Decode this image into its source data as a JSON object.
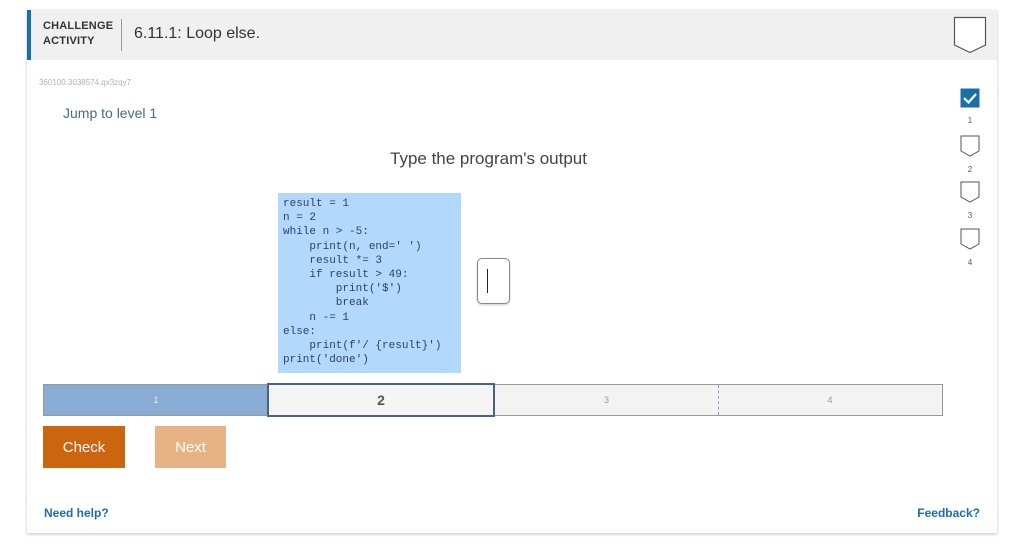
{
  "header": {
    "tag_line1": "CHALLENGE",
    "tag_line2": "ACTIVITY",
    "title": "6.11.1: Loop else."
  },
  "activity_id": "360100.3038574.qx3zqy7",
  "jump_link": "Jump to level 1",
  "prompt": "Type the program's output",
  "code_lines": [
    "result = 1",
    "n = 2",
    "while n > -5:",
    "    print(n, end=' ')",
    "    result *= 3",
    "    if result > 49:",
    "        print('$')",
    "        break",
    "    n -= 1",
    "else:",
    "    print(f'/ {result}')",
    "print('done')"
  ],
  "answer": {
    "value": ""
  },
  "side_levels": [
    {
      "num": "1",
      "state": "completed"
    },
    {
      "num": "2",
      "state": "pending"
    },
    {
      "num": "3",
      "state": "pending"
    },
    {
      "num": "4",
      "state": "pending"
    }
  ],
  "progress": {
    "segments": [
      {
        "label": "1",
        "state": "done"
      },
      {
        "label": "2",
        "state": "current"
      },
      {
        "label": "3",
        "state": "pending"
      },
      {
        "label": "4",
        "state": "pending"
      }
    ]
  },
  "buttons": {
    "check": "Check",
    "next": "Next"
  },
  "footer": {
    "help": "Need help?",
    "feedback": "Feedback?"
  },
  "colors": {
    "accent": "#1b6fa8",
    "check_button": "#cc6510",
    "next_button_disabled": "#e7b384",
    "code_background": "#b3d8fe",
    "progress_done": "#88acd3",
    "level_completed": "#1b6fa8"
  },
  "icons": {
    "header_badge": "shield-badge-icon",
    "level_completed": "checkbox-checked-icon",
    "level_pending": "shield-outline-icon"
  }
}
